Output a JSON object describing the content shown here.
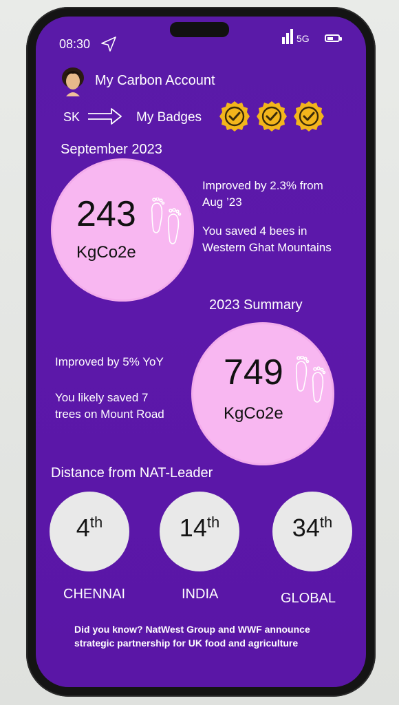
{
  "status": {
    "time": "08:30",
    "network": "5G"
  },
  "header": {
    "title": "My Carbon Account",
    "user_initials": "SK",
    "badges_label": "My Badges",
    "badge_count": 3
  },
  "month": {
    "label": "September 2023",
    "value": "243",
    "unit": "KgCo2e",
    "note1": [
      "Improved by 2.3% from",
      "Aug ’23"
    ],
    "note2": [
      "You saved 4 bees in",
      "Western Ghat Mountains"
    ]
  },
  "summary": {
    "label": "2023 Summary",
    "value": "749",
    "unit": "KgCo2e",
    "note1": "Improved by 5% YoY",
    "note2": [
      "You likely saved 7",
      "trees on Mount Road"
    ]
  },
  "distance": {
    "title": "Distance from NAT-Leader",
    "ranks": [
      {
        "num": "4",
        "suffix": "th",
        "label": "CHENNAI"
      },
      {
        "num": "14",
        "suffix": "th",
        "label": "INDIA"
      },
      {
        "num": "34",
        "suffix": "th",
        "label": "GLOBAL"
      }
    ]
  },
  "fact": "Did you know? NatWest Group and WWF announce strategic partnership for UK food and agriculture",
  "colors": {
    "background": "#5a18a8",
    "circle_pink": "#f8b7f1",
    "badge_gold": "#f3b51c",
    "rank_circle": "#e9e9e9"
  },
  "icons": [
    "send-icon",
    "signal-icon",
    "battery-icon",
    "avatar",
    "arrow-icon",
    "check-badge-icon",
    "footprints-icon"
  ]
}
